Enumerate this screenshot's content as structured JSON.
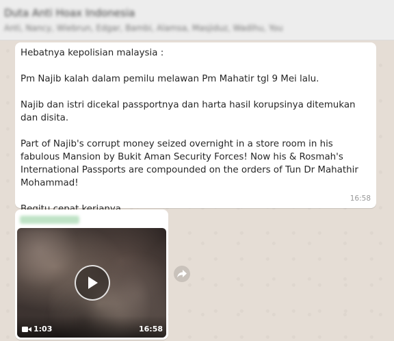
{
  "header": {
    "chat_title": "Duta Anti Hoax Indonesia",
    "members": "Anti, Nancy, Wiebrun, Edgar, Bambi, Alamsa, Masjiduz, Wadihu, You"
  },
  "messages": [
    {
      "type": "text",
      "paragraphs": [
        "Hebatnya kepolisian malaysia :",
        "Pm Najib kalah dalam pemilu melawan Pm Mahatir tgl 9 Mei lalu.",
        "Najib dan istri dicekal passportnya dan harta hasil korupsinya ditemukan dan disita.",
        "Part of Najib's corrupt money seized overnight in a store room in his fabulous Mansion by Bukit Aman Security Forces!  Now his & Rosmah's International Passports are compounded on the orders of Tun Dr Mahathir Mohammad!",
        "Begitu cepat kerjanya"
      ],
      "time": "16:58"
    },
    {
      "type": "video",
      "forwarded_from": "Redacted",
      "duration": "1:03",
      "time": "16:58"
    }
  ],
  "colors": {
    "chat_background": "#e5ddd5",
    "header_background": "#ededed",
    "bubble": "#ffffff"
  },
  "icons": {
    "play": "play-icon",
    "video_camera": "video-camera-icon",
    "forward": "forward-icon"
  }
}
